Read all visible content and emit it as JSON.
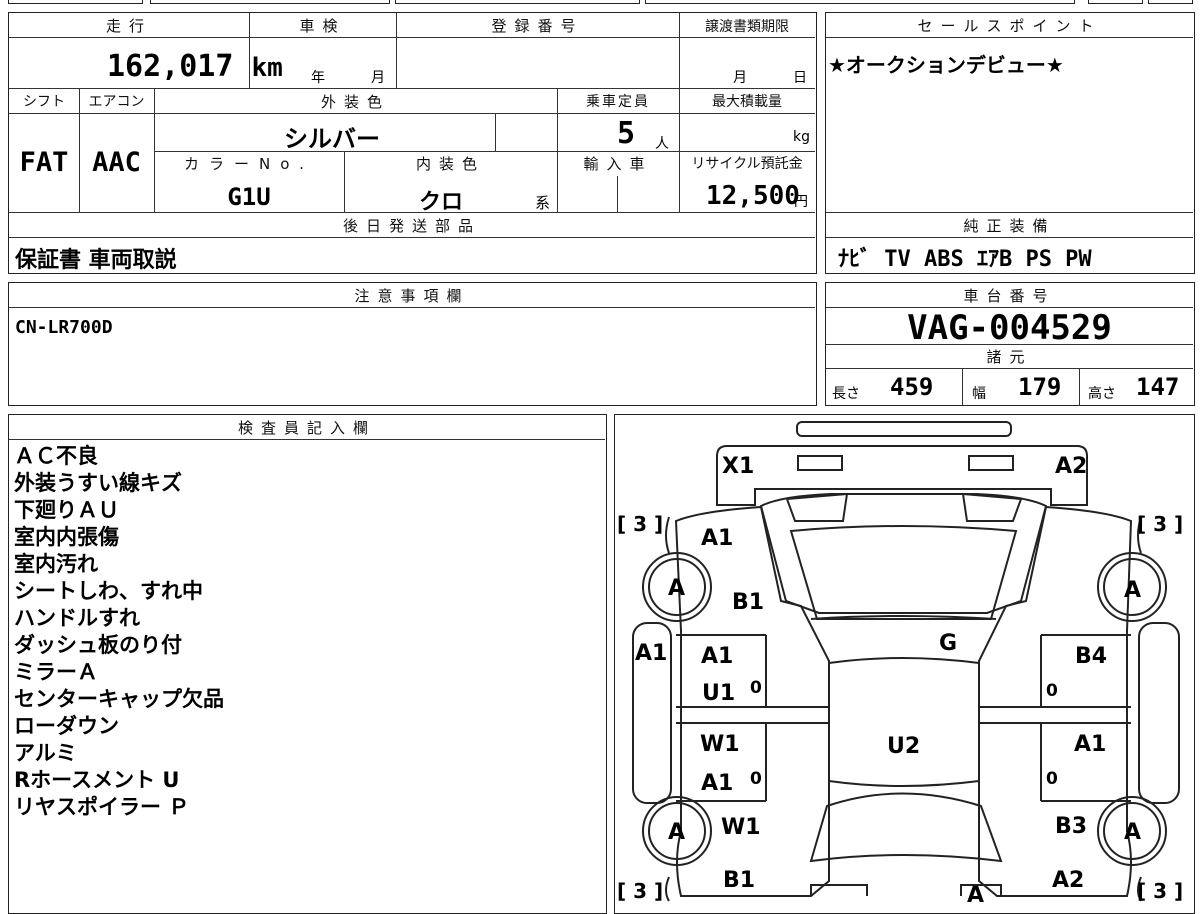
{
  "mileage": {
    "header": "走行",
    "value": "162,017",
    "unit": "km"
  },
  "inspection": {
    "header": "車検",
    "year_label": "年",
    "month_label": "月"
  },
  "registration": {
    "header": "登録番号"
  },
  "transfer_deadline": {
    "header": "譲渡書類期限",
    "month_label": "月",
    "day_label": "日"
  },
  "shift": {
    "header": "シフト",
    "value": "FAT"
  },
  "aircon": {
    "header": "エアコン",
    "value": "AAC"
  },
  "exterior_color": {
    "header": "外装色",
    "value": "シルバー"
  },
  "capacity": {
    "header": "乗車定員",
    "value": "5",
    "unit": "人"
  },
  "max_load": {
    "header": "最大積載量",
    "unit": "kg"
  },
  "color_no": {
    "header": "カラーNo.",
    "value": "G1U"
  },
  "interior_color": {
    "header": "内装色",
    "value": "クロ",
    "suffix": "系"
  },
  "import_car": {
    "header": "輸入車"
  },
  "recycle": {
    "header": "リサイクル預託金",
    "value": "12,500",
    "unit": "円"
  },
  "later_parts": {
    "header": "後日発送部品",
    "value": "保証書 車両取説"
  },
  "notes": {
    "header": "注意事項欄",
    "value": "CN-LR700D"
  },
  "sales_point": {
    "header": "セールスポイント",
    "value": "★オークションデビュー★"
  },
  "equipment": {
    "header": "純正装備",
    "value": "ﾅﾋﾞ TV ABS ｴｱB PS PW"
  },
  "chassis": {
    "header": "車台番号",
    "value": "VAG-004529"
  },
  "specs": {
    "header": "諸元",
    "length_label": "長さ",
    "length": "459",
    "width_label": "幅",
    "width": "179",
    "height_label": "高さ",
    "height": "147"
  },
  "inspector": {
    "header": "検査員記入欄",
    "remarks": [
      "ＡＣ不良",
      "外装うすい線キズ",
      "下廻りＡＵ",
      "室内内張傷",
      "室内汚れ",
      "シートしわ、すれ中",
      "ハンドルすれ",
      "ダッシュ板のり付",
      "ミラーＡ",
      "センターキャップ欠品",
      "ローダウン",
      "アルミ",
      "Rホースメント U",
      "リヤスポイラー Ｐ"
    ]
  },
  "diagram": {
    "marks": {
      "x1": "X1",
      "a2_top": "A2",
      "a1_hood": "A1",
      "b1_hood": "B1",
      "a1_left_side": "A1",
      "g": "G",
      "a1_front_left_door": "A1",
      "u1_front_left_door": "U1",
      "b4_front_right_door": "B4",
      "w1_rear_left_door": "W1",
      "a1_rear_left_door": "A1",
      "u2": "U2",
      "a1_rear_right_door": "A1",
      "w1_rear_left_fender": "W1",
      "b3_rear_right": "B3",
      "b1_bottom": "B1",
      "a2_bottom": "A2",
      "wheel_fl": "A",
      "wheel_fr": "A",
      "wheel_rl": "A",
      "wheel_rr": "A",
      "zero_1": "0",
      "zero_2": "0",
      "zero_3": "0",
      "zero_4": "0",
      "tire_fl": "[ 3 ]",
      "tire_fr": "[ 3 ]",
      "tire_rl": "[ 3 ]",
      "tire_rr": "[ 3 ]",
      "a_bottom": "A"
    }
  }
}
